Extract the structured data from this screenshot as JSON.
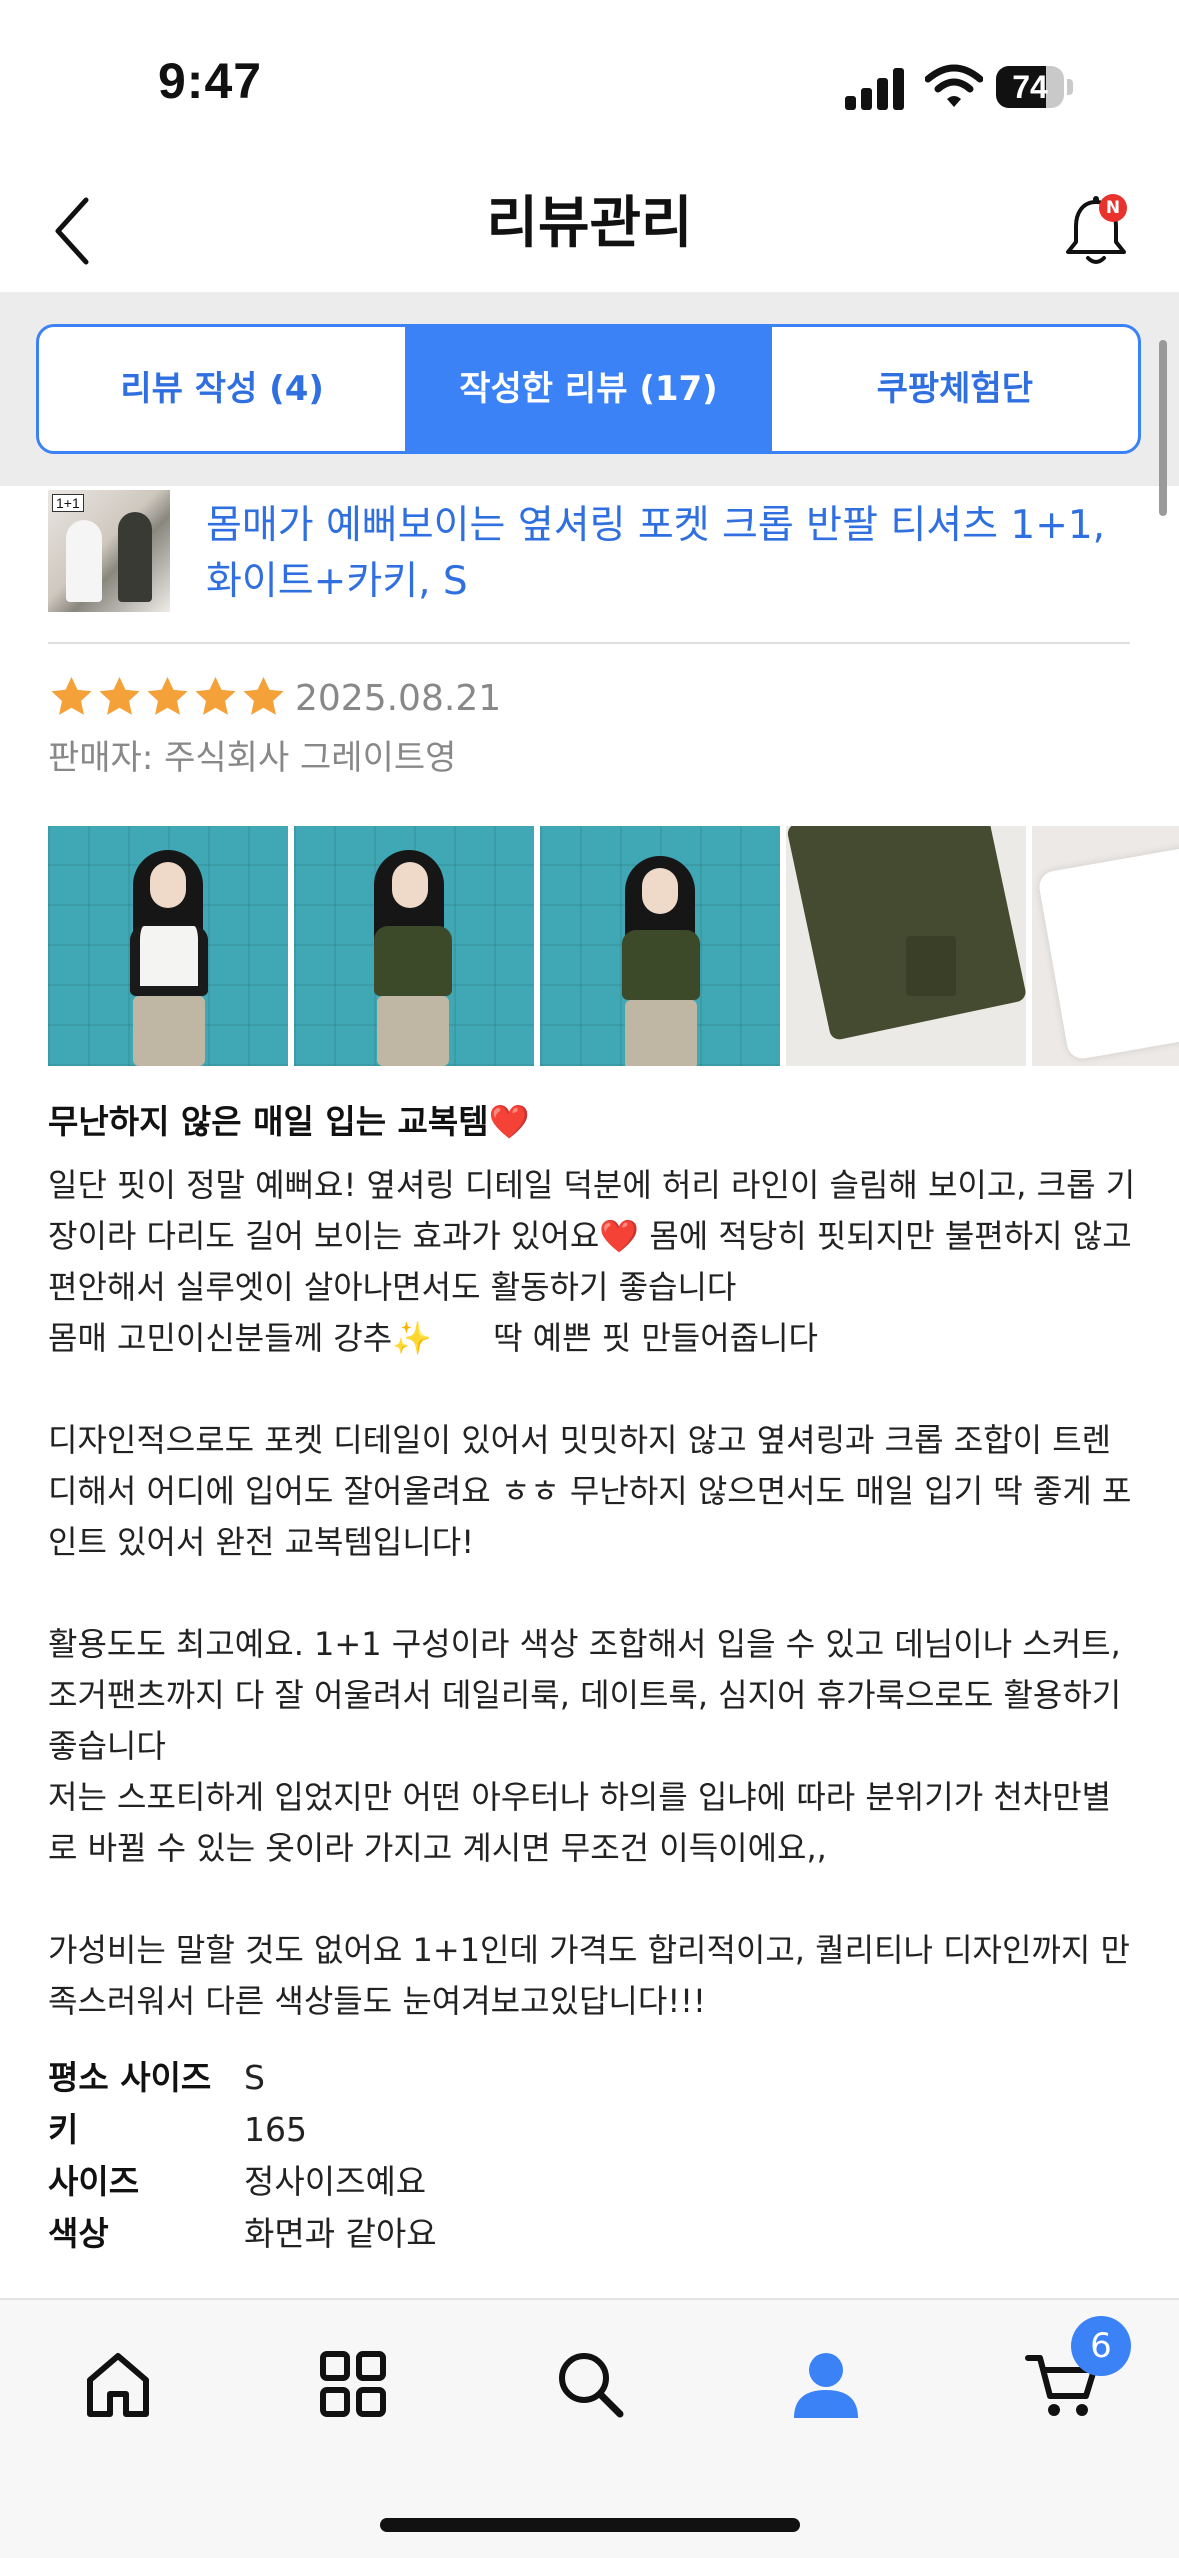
{
  "status_bar": {
    "time": "9:47",
    "battery": "74",
    "battery_level": 0.74
  },
  "header": {
    "title": "리뷰관리",
    "notification_badge": "N"
  },
  "tabs": [
    {
      "label": "리뷰 작성 (4)",
      "active": false
    },
    {
      "label": "작성한 리뷰 (17)",
      "active": true
    },
    {
      "label": "쿠팡체험단",
      "active": false
    }
  ],
  "product": {
    "thumbnail_tag": "1+1",
    "title": "몸매가 예뻐보이는 옆셔링 포켓 크롭 반팔 티셔츠 1+1, 화이트+카키, S"
  },
  "review": {
    "rating": 5,
    "max_rating": 5,
    "date": "2025.08.21",
    "seller": "판매자: 주식회사 그레이트영",
    "photo_count": 5,
    "headline": "무난하지 않은 매일 입는 교복템",
    "paragraphs": [
      "일단 핏이 정말 예뻐요! 옆셔링 디테일 덕분에 허리 라인이 슬림해 보이고, 크롭 기장이라 다리도 길어 보이는 효과가 있어요",
      " 몸에 적당히 핏되지만 불편하지 않고 편안해서 실루엣이 살아나면서도 활동하기 좋습니다\n몸매 고민이신분들께 강추",
      "      딱 예쁜 핏 만들어줍니다\n\n디자인적으로도 포켓 디테일이 있어서 밋밋하지 않고 옆셔링과 크롭 조합이 트렌디해서 어디에 입어도 잘어울려요 ㅎㅎ 무난하지 않으면서도 매일 입기 딱 좋게 포인트 있어서 완전 교복템입니다!\n\n활용도도 최고예요. 1+1 구성이라 색상 조합해서 입을 수 있고 데님이나 스커트, 조거팬츠까지 다 잘 어울려서 데일리룩, 데이트룩, 심지어 휴가룩으로도 활용하기 좋습니다\n저는 스포티하게 입었지만 어떤 아우터나 하의를 입냐에 따라 분위기가 천차만별로 바뀔 수 있는 옷이라 가지고 계시면 무조건 이득이에요,,\n\n가성비는 말할 것도 없어요 1+1인데 가격도 합리적이고, 퀄리티나 디자인까지 만족스러워서 다른 색상들도 눈여겨보고있답니다!!!"
    ],
    "emoji_heart": "❤️",
    "emoji_sparkles": "✨",
    "specs": [
      {
        "label": "평소 사이즈",
        "value": "S"
      },
      {
        "label": "키",
        "value": "165"
      },
      {
        "label": "사이즈",
        "value": "정사이즈예요"
      },
      {
        "label": "색상",
        "value": "화면과 같아요"
      }
    ]
  },
  "bottom_nav": {
    "items": [
      "home-icon",
      "category-icon",
      "search-icon",
      "my-coupang-icon",
      "cart-icon"
    ],
    "active": "my-coupang-icon",
    "cart_count": "6"
  },
  "colors": {
    "accent": "#3b82f6",
    "link": "#2f6fe0",
    "star": "#f5a13a",
    "badge_red": "#e8322b"
  }
}
